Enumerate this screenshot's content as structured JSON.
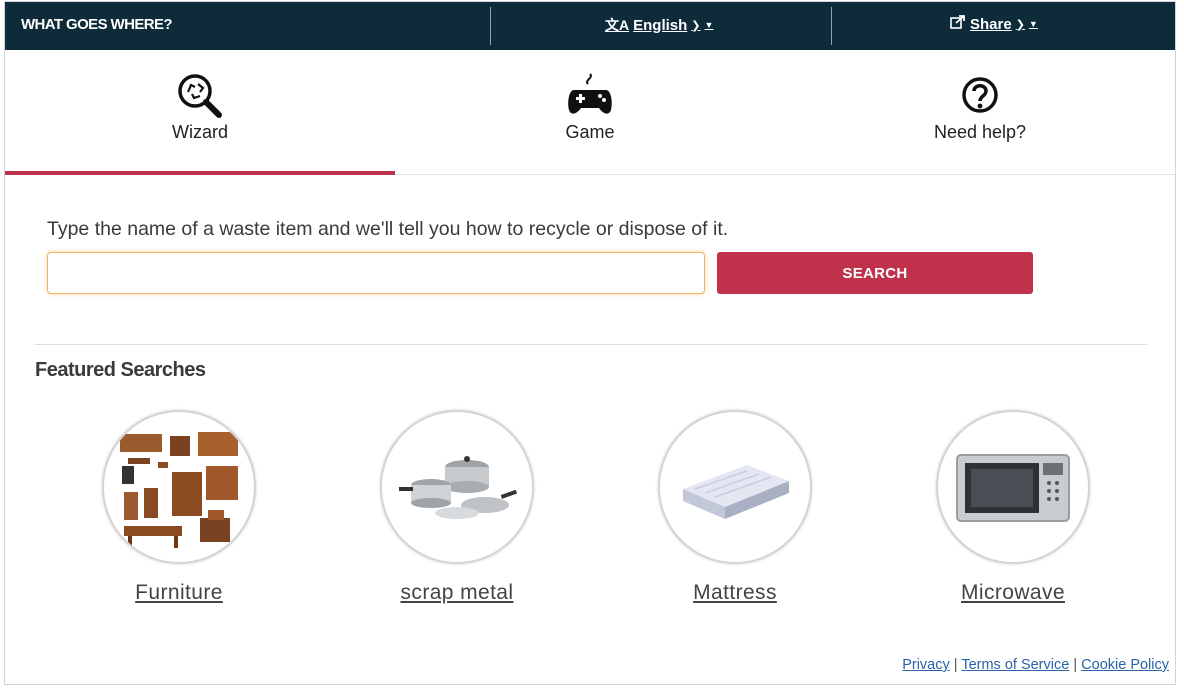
{
  "header": {
    "brand": "WHAT GOES WHERE?",
    "language": {
      "icon": "translate-icon",
      "label": "English"
    },
    "share": {
      "icon": "share-icon",
      "label": "Share"
    },
    "colors": {
      "bar": "#0e2b3a",
      "accent": "#c0324b"
    }
  },
  "tabs": [
    {
      "label": "Wizard",
      "icon": "recycle-search-icon",
      "active": true
    },
    {
      "label": "Game",
      "icon": "gamepad-icon",
      "active": false
    },
    {
      "label": "Need help?",
      "icon": "question-circle-icon",
      "active": false
    }
  ],
  "search": {
    "prompt": "Type the name of a waste item and we'll tell you how to recycle or dispose of it.",
    "value": "",
    "button_label": "SEARCH"
  },
  "featured": {
    "title": "Featured Searches",
    "items": [
      {
        "label": "Furniture",
        "image": "furniture-image"
      },
      {
        "label": "scrap metal",
        "image": "cookware-image"
      },
      {
        "label": "Mattress",
        "image": "mattress-image"
      },
      {
        "label": "Microwave",
        "image": "microwave-image"
      }
    ]
  },
  "footer": {
    "privacy": "Privacy",
    "terms": "Terms of Service",
    "cookie": "Cookie Policy",
    "separator": "|"
  }
}
